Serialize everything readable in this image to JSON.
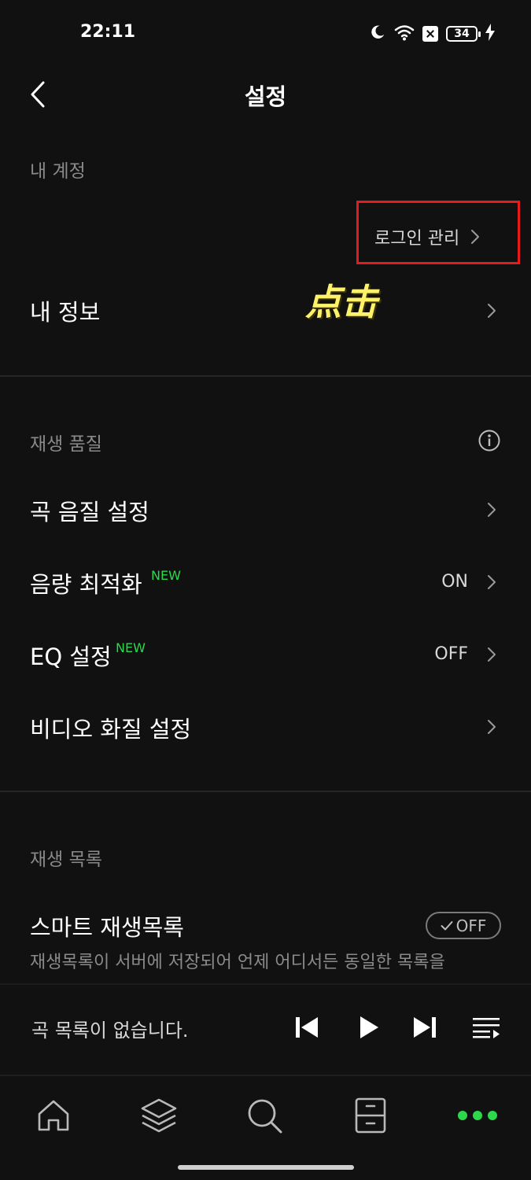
{
  "status_bar": {
    "time": "22:11",
    "battery": "34"
  },
  "header": {
    "title": "설정"
  },
  "account": {
    "section_title": "내 계정",
    "login_manage": "로그인 관리",
    "my_info": "내 정보"
  },
  "annotation": {
    "text": "点击",
    "color": "#fff26b",
    "highlight_color": "#e61b1b"
  },
  "playback_quality": {
    "section_title": "재생 품질",
    "items": [
      {
        "label": "곡 음질 설정",
        "new": "",
        "value": ""
      },
      {
        "label": "음량 최적화",
        "new": "NEW",
        "value": "ON"
      },
      {
        "label": "EQ 설정",
        "new": "NEW",
        "value": "OFF"
      },
      {
        "label": "비디오 화질 설정",
        "new": "",
        "value": ""
      }
    ]
  },
  "playlist": {
    "section_title": "재생 목록",
    "smart_label": "스마트 재생목록",
    "smart_toggle": "OFF",
    "smart_desc": "재생목록이 서버에 저장되어 언제 어디서든 동일한 목록을"
  },
  "player": {
    "empty_message": "곡 목록이 없습니다."
  },
  "tabs": [
    {
      "name": "home-icon"
    },
    {
      "name": "layers-icon"
    },
    {
      "name": "search-icon"
    },
    {
      "name": "drawer-icon"
    },
    {
      "name": "more-icon",
      "active_color": "#2bd94a"
    }
  ]
}
